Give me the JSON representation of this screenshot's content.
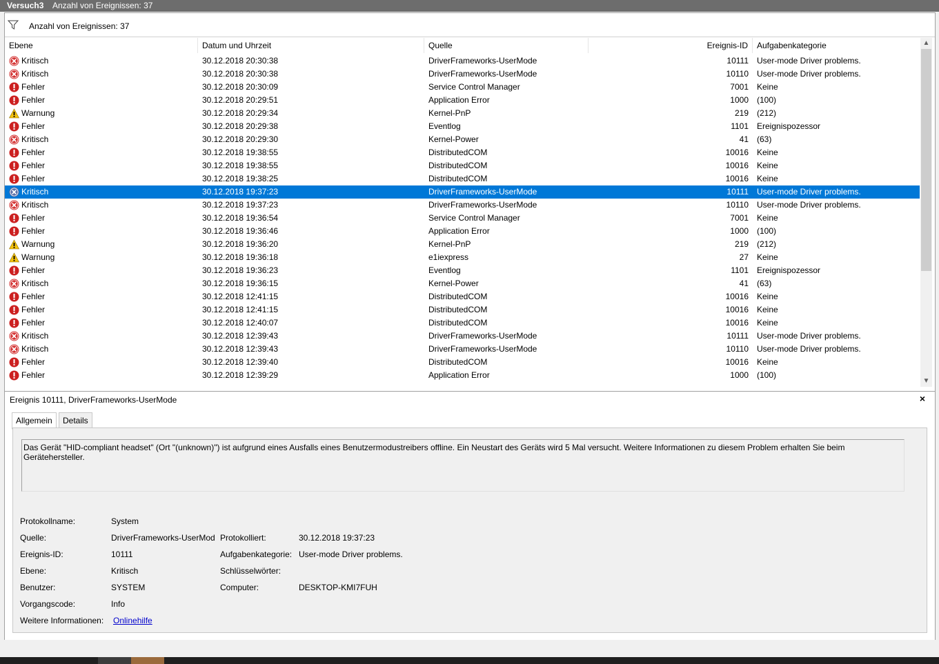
{
  "window": {
    "title": "Versuch3",
    "subtitle": "Anzahl von Ereignissen: 37"
  },
  "filter": {
    "text": "Anzahl von Ereignissen: 37"
  },
  "columns": {
    "level": "Ebene",
    "date": "Datum und Uhrzeit",
    "source": "Quelle",
    "id": "Ereignis-ID",
    "category": "Aufgabenkategorie"
  },
  "rows": [
    {
      "level": "Kritisch",
      "date": "30.12.2018 20:30:38",
      "source": "DriverFrameworks-UserMode",
      "id": "10111",
      "category": "User-mode Driver problems."
    },
    {
      "level": "Kritisch",
      "date": "30.12.2018 20:30:38",
      "source": "DriverFrameworks-UserMode",
      "id": "10110",
      "category": "User-mode Driver problems."
    },
    {
      "level": "Fehler",
      "date": "30.12.2018 20:30:09",
      "source": "Service Control Manager",
      "id": "7001",
      "category": "Keine"
    },
    {
      "level": "Fehler",
      "date": "30.12.2018 20:29:51",
      "source": "Application Error",
      "id": "1000",
      "category": "(100)"
    },
    {
      "level": "Warnung",
      "date": "30.12.2018 20:29:34",
      "source": "Kernel-PnP",
      "id": "219",
      "category": "(212)"
    },
    {
      "level": "Fehler",
      "date": "30.12.2018 20:29:38",
      "source": "Eventlog",
      "id": "1101",
      "category": "Ereignispozessor"
    },
    {
      "level": "Kritisch",
      "date": "30.12.2018 20:29:30",
      "source": "Kernel-Power",
      "id": "41",
      "category": "(63)"
    },
    {
      "level": "Fehler",
      "date": "30.12.2018 19:38:55",
      "source": "DistributedCOM",
      "id": "10016",
      "category": "Keine"
    },
    {
      "level": "Fehler",
      "date": "30.12.2018 19:38:55",
      "source": "DistributedCOM",
      "id": "10016",
      "category": "Keine"
    },
    {
      "level": "Fehler",
      "date": "30.12.2018 19:38:25",
      "source": "DistributedCOM",
      "id": "10016",
      "category": "Keine"
    },
    {
      "level": "Kritisch",
      "date": "30.12.2018 19:37:23",
      "source": "DriverFrameworks-UserMode",
      "id": "10111",
      "category": "User-mode Driver problems.",
      "selected": true
    },
    {
      "level": "Kritisch",
      "date": "30.12.2018 19:37:23",
      "source": "DriverFrameworks-UserMode",
      "id": "10110",
      "category": "User-mode Driver problems."
    },
    {
      "level": "Fehler",
      "date": "30.12.2018 19:36:54",
      "source": "Service Control Manager",
      "id": "7001",
      "category": "Keine"
    },
    {
      "level": "Fehler",
      "date": "30.12.2018 19:36:46",
      "source": "Application Error",
      "id": "1000",
      "category": "(100)"
    },
    {
      "level": "Warnung",
      "date": "30.12.2018 19:36:20",
      "source": "Kernel-PnP",
      "id": "219",
      "category": "(212)"
    },
    {
      "level": "Warnung",
      "date": "30.12.2018 19:36:18",
      "source": "e1iexpress",
      "id": "27",
      "category": "Keine"
    },
    {
      "level": "Fehler",
      "date": "30.12.2018 19:36:23",
      "source": "Eventlog",
      "id": "1101",
      "category": "Ereignispozessor"
    },
    {
      "level": "Kritisch",
      "date": "30.12.2018 19:36:15",
      "source": "Kernel-Power",
      "id": "41",
      "category": "(63)"
    },
    {
      "level": "Fehler",
      "date": "30.12.2018 12:41:15",
      "source": "DistributedCOM",
      "id": "10016",
      "category": "Keine"
    },
    {
      "level": "Fehler",
      "date": "30.12.2018 12:41:15",
      "source": "DistributedCOM",
      "id": "10016",
      "category": "Keine"
    },
    {
      "level": "Fehler",
      "date": "30.12.2018 12:40:07",
      "source": "DistributedCOM",
      "id": "10016",
      "category": "Keine"
    },
    {
      "level": "Kritisch",
      "date": "30.12.2018 12:39:43",
      "source": "DriverFrameworks-UserMode",
      "id": "10111",
      "category": "User-mode Driver problems."
    },
    {
      "level": "Kritisch",
      "date": "30.12.2018 12:39:43",
      "source": "DriverFrameworks-UserMode",
      "id": "10110",
      "category": "User-mode Driver problems."
    },
    {
      "level": "Fehler",
      "date": "30.12.2018 12:39:40",
      "source": "DistributedCOM",
      "id": "10016",
      "category": "Keine"
    },
    {
      "level": "Fehler",
      "date": "30.12.2018 12:39:29",
      "source": "Application Error",
      "id": "1000",
      "category": "(100)"
    }
  ],
  "detail": {
    "title": "Ereignis 10111, DriverFrameworks-UserMode",
    "close": "×",
    "tabs": [
      "Allgemein",
      "Details"
    ],
    "message": "Das Gerät \"HID-compliant headset\" (Ort \"(unknown)\") ist aufgrund eines Ausfalls eines Benutzermodustreibers offline. Ein Neustart des Geräts wird 5 Mal versucht. Weitere Informationen zu diesem Problem erhalten Sie beim Gerätehersteller.",
    "labels": {
      "log": "Protokollname:",
      "source": "Quelle:",
      "eventid": "Ereignis-ID:",
      "level": "Ebene:",
      "user": "Benutzer:",
      "opcode": "Vorgangscode:",
      "more": "Weitere Informationen:",
      "logged": "Protokolliert:",
      "category": "Aufgabenkategorie:",
      "keywords": "Schlüsselwörter:",
      "computer": "Computer:"
    },
    "values": {
      "log": "System",
      "source": "DriverFrameworks-UserMod",
      "eventid": "10111",
      "level": "Kritisch",
      "user": "SYSTEM",
      "opcode": "Info",
      "more": "Onlinehilfe",
      "logged": "30.12.2018 19:37:23",
      "category": "User-mode Driver problems.",
      "keywords": "",
      "computer": "DESKTOP-KMI7FUH"
    }
  },
  "icons": {
    "critical": "critical-icon",
    "error": "error-icon",
    "warning": "warning-icon",
    "filter": "filter-icon"
  },
  "colors": {
    "selection": "#0078d7",
    "critical": "#d32f2f",
    "error": "#cc2020",
    "warning": "#f4c20d",
    "link": "#0000cc"
  }
}
